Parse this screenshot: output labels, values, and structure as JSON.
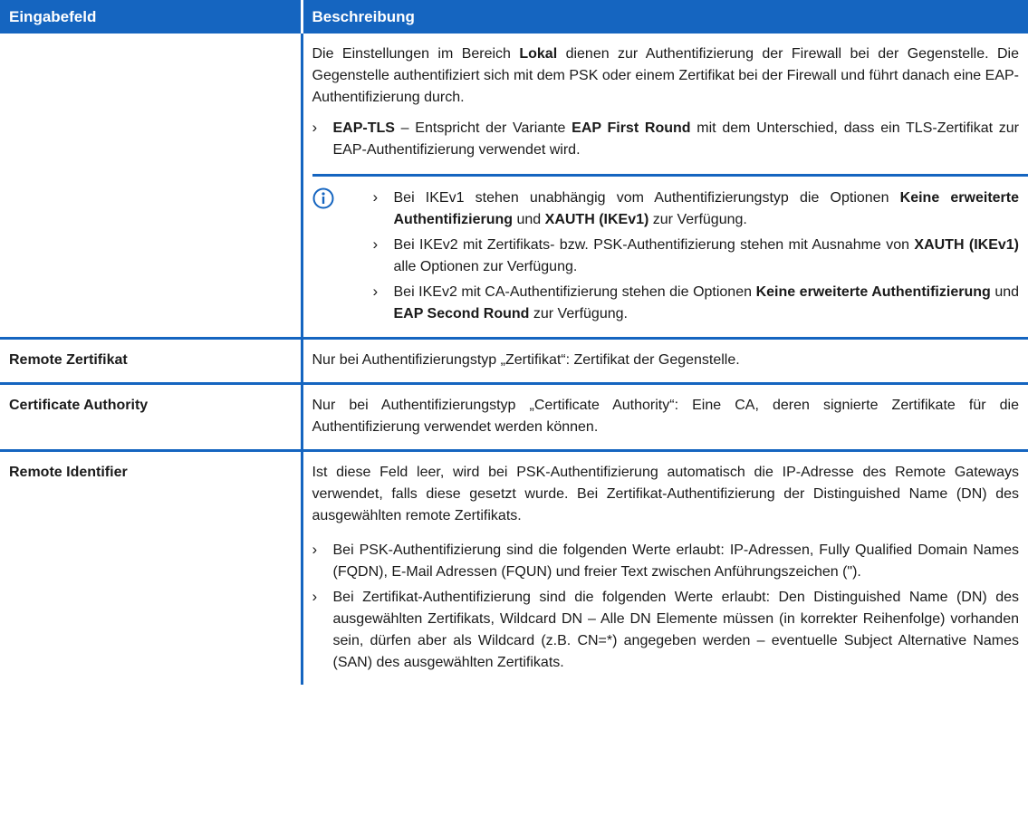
{
  "header": {
    "col1": "Eingabefeld",
    "col2": "Beschreibung"
  },
  "row1": {
    "para_a": "Die Einstellungen im Bereich ",
    "para_b": "Lokal",
    "para_c": " dienen zur Authentifizierung der Firewall bei der Gegenstelle. Die Gegenstelle authentifiziert sich mit dem PSK oder einem Zertifikat bei der Firewall und führt danach eine EAP-Authentifizierung durch.",
    "bullet_a": "EAP-TLS",
    "bullet_b": " – Entspricht der Variante ",
    "bullet_c": "EAP First Round",
    "bullet_d": " mit dem Unterschied, dass ein TLS-Zertifikat zur EAP-Authentifizierung verwendet wird.",
    "notes": {
      "n1_a": "Bei IKEv1 stehen unabhängig vom Authentifizierungstyp die Optionen ",
      "n1_b": "Keine erweiterte Authentifizierung",
      "n1_c": " und ",
      "n1_d": "XAUTH (IKEv1)",
      "n1_e": " zur Verfügung.",
      "n2_a": "Bei IKEv2 mit Zertifikats- bzw. PSK-Authentifizierung stehen mit Ausnahme von ",
      "n2_b": "XAUTH (IKEv1)",
      "n2_c": " alle Optionen zur Verfügung.",
      "n3_a": "Bei IKEv2 mit CA-Authentifizierung stehen die Optionen ",
      "n3_b": "Keine erweiterte Authentifizierung",
      "n3_c": " und ",
      "n3_d": "EAP Second Round",
      "n3_e": " zur Verfügung."
    }
  },
  "row2": {
    "label": "Remote Zertifikat",
    "desc": "Nur bei Authentifizierungstyp „Zertifikat“: Zertifikat der Gegenstelle."
  },
  "row3": {
    "label": "Certificate Authority",
    "desc": "Nur bei Authentifizierungstyp „Certificate Authority“: Eine CA, deren signierte Zertifikate für die Authentifizierung verwendet werden können."
  },
  "row4": {
    "label": "Remote Identifier",
    "para": "Ist diese Feld leer, wird bei PSK-Authentifizierung automatisch die IP-Adresse des Remote Gateways verwendet, falls diese gesetzt wurde. Bei Zertifikat-Authentifizierung der Distinguished Name (DN) des ausgewählten remote Zertifikats.",
    "b1": "Bei PSK-Authentifizierung sind die folgenden Werte erlaubt: IP-Adressen, Fully Qualified Domain Names (FQDN), E-Mail Adressen (FQUN) und freier Text zwischen Anführungszeichen (\").",
    "b2": "Bei Zertifikat-Authentifizierung sind die folgenden Werte erlaubt: Den Distinguished Name (DN) des ausgewählten Zertifikats, Wildcard DN – Alle DN Elemente müssen (in korrekter Reihenfolge) vorhanden sein, dürfen aber als Wildcard (z.B. CN=*) angegeben werden – eventuelle Subject Alternative Names (SAN) des ausgewählten Zertifikats."
  },
  "icons": {
    "bullet": "›",
    "info": "info-icon"
  },
  "colors": {
    "accent": "#1565c0"
  }
}
